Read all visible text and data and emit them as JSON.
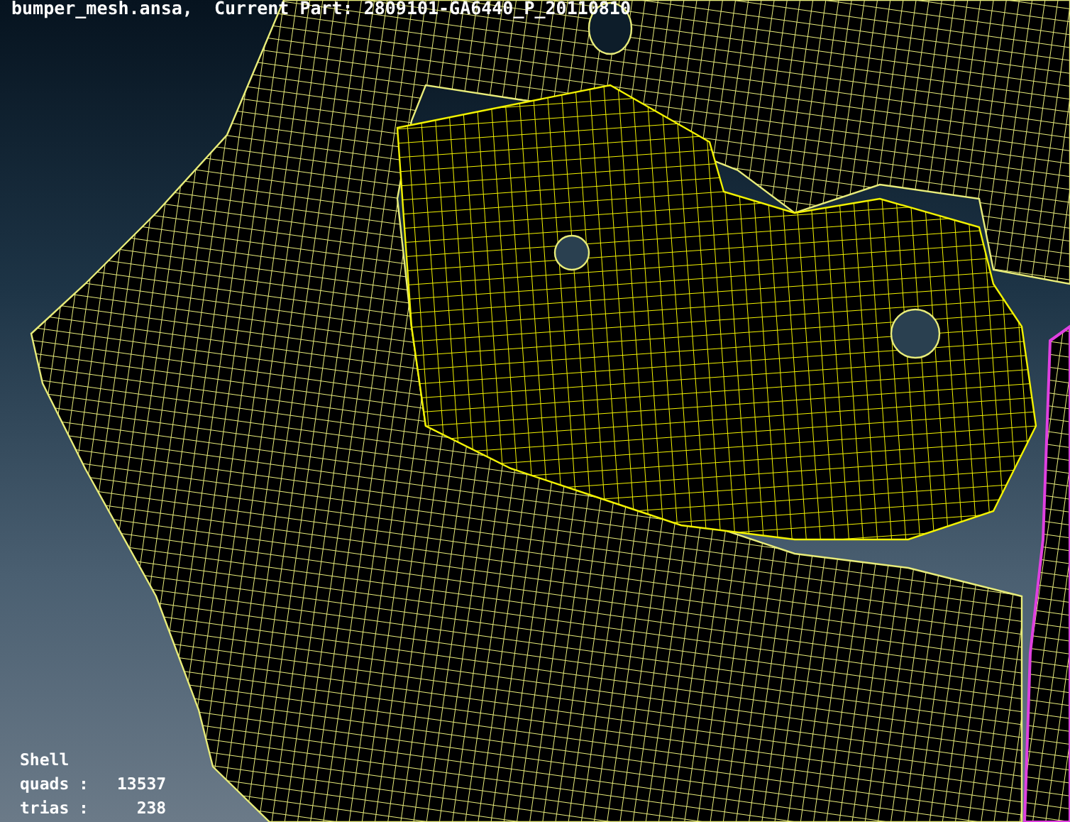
{
  "header": {
    "text": "bumper_mesh.ansa,  Current Part: 2809101-GA6440_P_20110810"
  },
  "stats": {
    "heading": "Shell",
    "rows": [
      {
        "label": "quads :",
        "value": "13537"
      },
      {
        "label": "trias :",
        "value": "238"
      }
    ]
  }
}
